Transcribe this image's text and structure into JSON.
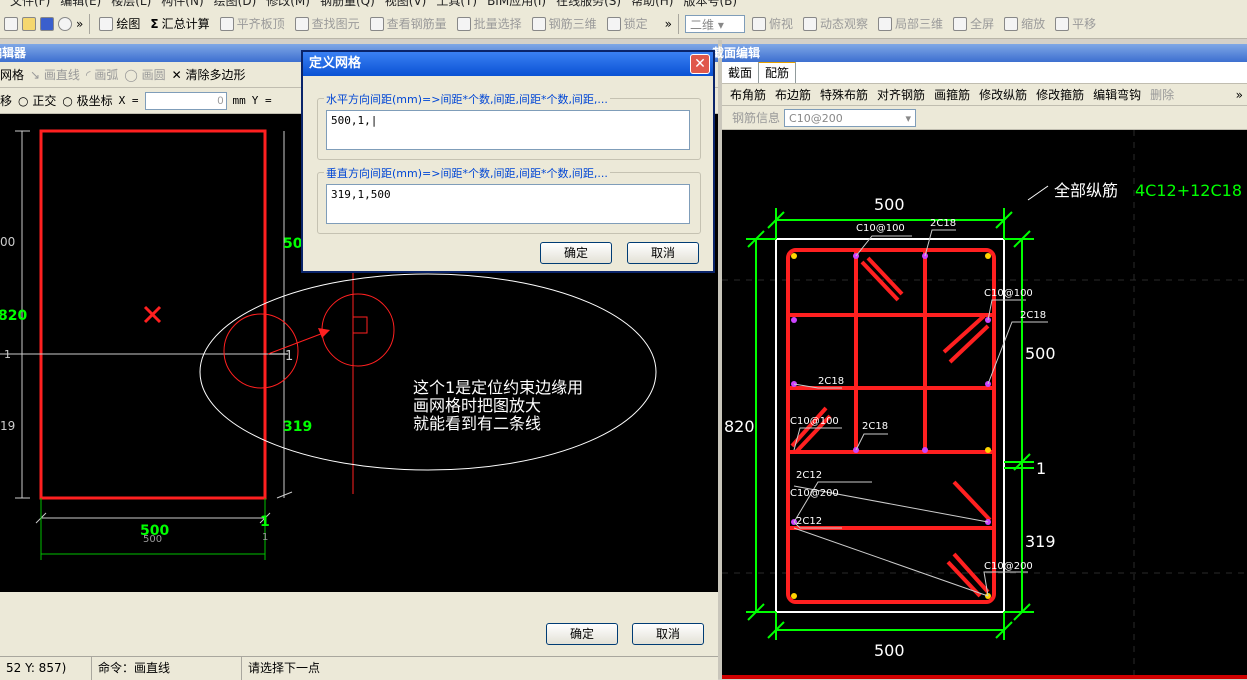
{
  "menu": [
    "文件(F)",
    "编辑(E)",
    "楼层(L)",
    "构件(N)",
    "绘图(D)",
    "修改(M)",
    "钢筋量(Q)",
    "视图(V)",
    "工具(T)",
    "BIM应用(I)",
    "在线服务(S)",
    "帮助(H)",
    "版本号(B)"
  ],
  "toolbar": {
    "draw": "绘图",
    "sum": "Σ",
    "calc": "汇总计算",
    "align_slab": "平齐板顶",
    "find_element": "查找图元",
    "view_rebar": "查看钢筋量",
    "batch_select": "批量选择",
    "rebar_3d": "钢筋三维",
    "lock": "锁定",
    "view_mode": "二维",
    "top_view": "俯视",
    "dynamic_view": "动态观察",
    "local_3d": "局部三维",
    "fullscreen": "全屏",
    "zoom": "缩放",
    "pan": "平移",
    "more": "»"
  },
  "left_panel": {
    "title": "编辑器",
    "tools": {
      "grid": "网格",
      "line": "画直线",
      "arc": "画弧",
      "circle": "画圆",
      "clear_polygon": "清除多边形"
    },
    "coords": {
      "move": "移",
      "orthogonal": "正交",
      "polar": "极坐标",
      "x_label": "X =",
      "x_value": "0",
      "unit": "mm",
      "y_label": "Y ="
    },
    "drawing": {
      "dim_500_left": "00",
      "dim_820": "820",
      "dim_1": "1",
      "dim_19": "19",
      "dim_50_right": "50",
      "dim_1_right": "1",
      "dim_319": "319",
      "dim_500_bottom": "500",
      "dim_500_bottom_small": "500",
      "dim_1_bottom": "1",
      "dim_1_bottom_small": "1",
      "annotation": [
        "这个1是定位约束边缘用",
        "画网格时把图放大",
        "就能看到有二条线"
      ]
    },
    "ok": "确定",
    "cancel": "取消"
  },
  "dialog": {
    "title": "定义网格",
    "horizontal_label": "水平方向间距(mm)=>间距*个数,间距,间距*个数,间距,...",
    "horizontal_value": "500,1,",
    "vertical_label": "垂直方向间距(mm)=>间距*个数,间距,间距*个数,间距,...",
    "vertical_value": "319,1,500",
    "ok": "确定",
    "cancel": "取消",
    "close": "✕"
  },
  "status": {
    "coords": "52 Y: 857)",
    "command": "命令：画直线",
    "prompt": "请选择下一点"
  },
  "right_panel": {
    "title": "截面编辑",
    "tabs": [
      "截面",
      "配筋"
    ],
    "tools": [
      "布角筋",
      "布边筋",
      "特殊布筋",
      "对齐钢筋",
      "画箍筋",
      "修改纵筋",
      "修改箍筋",
      "编辑弯钩",
      "删除"
    ],
    "rebar_info_label": "钢筋信息",
    "rebar_info_value": "C10@200",
    "more": "»",
    "drawing": {
      "all_longitudinal_label": "全部纵筋",
      "all_longitudinal_value": "4C12+12C18",
      "top_500": "500",
      "bottom_500": "500",
      "left_820": "820",
      "right_500": "500",
      "right_1": "1",
      "right_319": "319",
      "labels": [
        "C10@100",
        "2C18",
        "C10@100",
        "2C18",
        "2C18",
        "C10@100",
        "2C18",
        "2C12",
        "C10@200",
        "2C12",
        "C10@200"
      ]
    }
  },
  "colors": {
    "rebar": "#ff2020",
    "dimension": "#00ff00",
    "canvas": "#000000",
    "title_bar": "#0a52d4"
  }
}
